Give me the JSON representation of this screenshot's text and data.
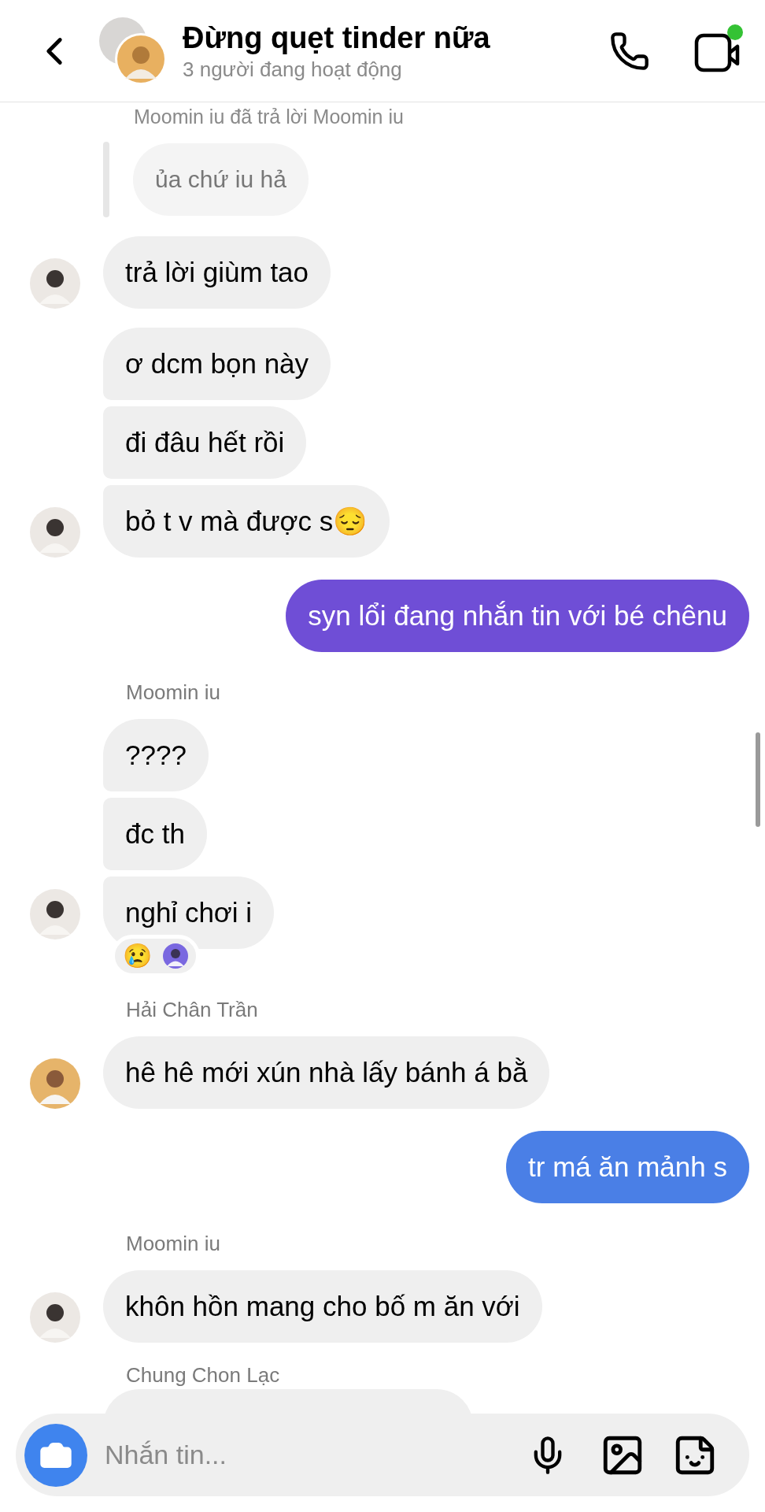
{
  "header": {
    "title": "Đừng quẹt tinder nữa",
    "subtitle": "3 người đang hoạt động",
    "video_active": true
  },
  "messages": [
    {
      "kind": "reply_note",
      "text": "Moomin iu đã trả lời Moomin iu"
    },
    {
      "kind": "quoted",
      "text": "ủa chứ iu hả"
    },
    {
      "kind": "received",
      "avatar": {
        "kind": "light"
      },
      "bubbles": [
        "trả lời giùm tao"
      ]
    },
    {
      "kind": "received",
      "avatar": {
        "kind": "light"
      },
      "bubbles": [
        "ơ dcm bọn này",
        "đi đâu hết rồi",
        "bỏ t v mà được s😔"
      ]
    },
    {
      "kind": "sent",
      "color": "#6f4ed6",
      "text": "syn lổi đang nhắn tin với bé chênu"
    },
    {
      "kind": "sender",
      "text": "Moomin iu"
    },
    {
      "kind": "received",
      "avatar": {
        "kind": "light"
      },
      "bubbles": [
        "????",
        "đc th",
        "nghỉ chơi i"
      ],
      "reaction": "😢"
    },
    {
      "kind": "sender",
      "text": "Hải Chân Trần"
    },
    {
      "kind": "received",
      "avatar": {
        "kind": "warm"
      },
      "bubbles": [
        "hê hê mới xún nhà lấy bánh á bằ"
      ]
    },
    {
      "kind": "sent",
      "color": "#4a7fe6",
      "text": "tr má ăn mảnh s"
    },
    {
      "kind": "sender",
      "text": "Moomin iu"
    },
    {
      "kind": "received",
      "avatar": {
        "kind": "light"
      },
      "bubbles": [
        "khôn hồn mang cho bố m ăn với"
      ]
    },
    {
      "kind": "sender",
      "text": "Chung Chon Lạc"
    },
    {
      "kind": "hidden_bubble"
    }
  ],
  "composer": {
    "placeholder": "Nhắn tin..."
  }
}
